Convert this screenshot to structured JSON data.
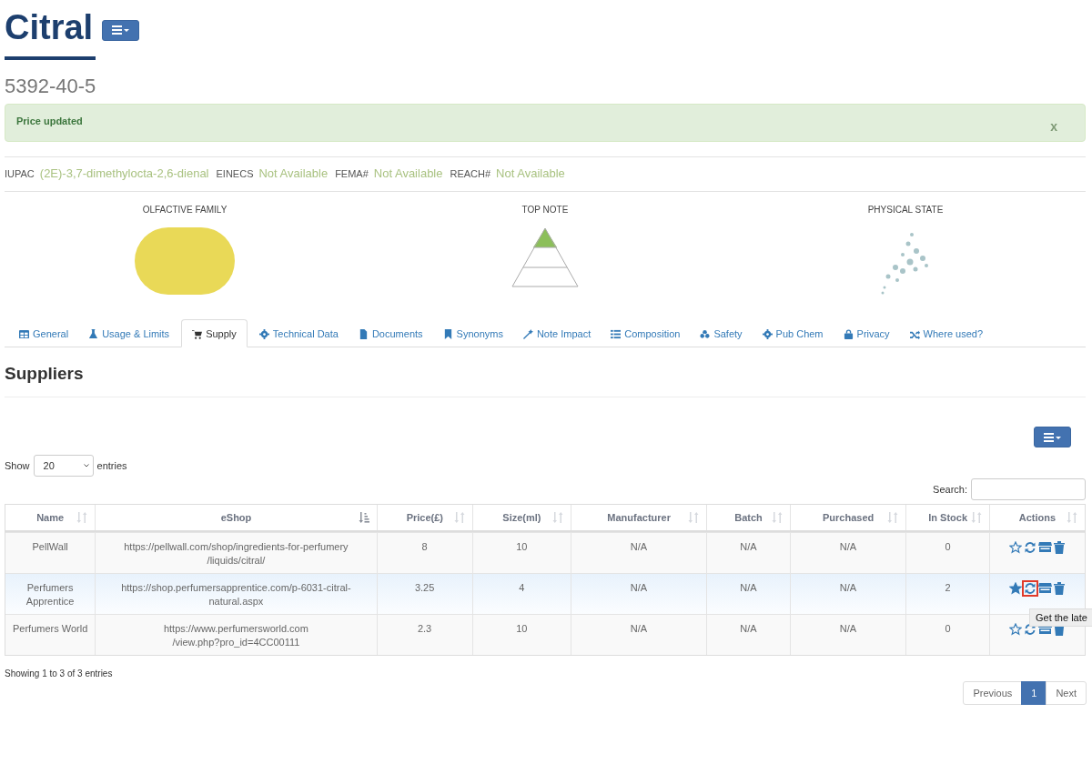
{
  "title": "Citral",
  "cas": "5392-40-5",
  "alert": {
    "text": "Price updated",
    "close": "x"
  },
  "identifiers": [
    {
      "label": "IUPAC",
      "value": "(2E)-3,7-dimethylocta-2,6-dienal"
    },
    {
      "label": "EINECS",
      "value": "Not Available"
    },
    {
      "label": "FEMA#",
      "value": "Not Available"
    },
    {
      "label": "REACH#",
      "value": "Not Available"
    }
  ],
  "profile": [
    {
      "label": "OLFACTIVE FAMILY",
      "kind": "photo"
    },
    {
      "label": "TOP NOTE",
      "kind": "pyramid"
    },
    {
      "label": "PHYSICAL STATE",
      "kind": "splash"
    }
  ],
  "tabs": [
    {
      "label": "General",
      "selected": false
    },
    {
      "label": "Usage & Limits",
      "selected": false
    },
    {
      "label": "Supply",
      "selected": true
    },
    {
      "label": "Technical Data",
      "selected": false
    },
    {
      "label": "Documents",
      "selected": false
    },
    {
      "label": "Synonyms",
      "selected": false
    },
    {
      "label": "Note Impact",
      "selected": false
    },
    {
      "label": "Composition",
      "selected": false
    },
    {
      "label": "Safety",
      "selected": false
    },
    {
      "label": "Pub Chem",
      "selected": false
    },
    {
      "label": "Privacy",
      "selected": false
    },
    {
      "label": "Where used?",
      "selected": false
    }
  ],
  "section_title": "Suppliers",
  "length": {
    "before": "Show",
    "value": "20",
    "after": "entries"
  },
  "search": {
    "label": "Search:"
  },
  "columns": [
    {
      "label": "Name",
      "sorted": false
    },
    {
      "label": "eShop",
      "sorted": true
    },
    {
      "label": "Price(£)",
      "sorted": false
    },
    {
      "label": "Size(ml)",
      "sorted": false
    },
    {
      "label": "Manufacturer",
      "sorted": false
    },
    {
      "label": "Batch",
      "sorted": false
    },
    {
      "label": "Purchased",
      "sorted": false
    },
    {
      "label": "In Stock",
      "sorted": false
    },
    {
      "label": "Actions",
      "sorted": false
    }
  ],
  "rows": [
    {
      "cells": [
        "PellWall",
        "https://pellwall.com/shop/ingredients-for-perfumery /liquids/citral/",
        "8",
        "10",
        "N/A",
        "N/A",
        "N/A",
        "0"
      ],
      "starred": false,
      "selected": false,
      "refresh_focused": false
    },
    {
      "cells": [
        "Perfumers Apprentice",
        "https://shop.perfumersapprentice.com/p-6031-citral-natural.aspx",
        "3.25",
        "4",
        "N/A",
        "N/A",
        "N/A",
        "2"
      ],
      "starred": true,
      "selected": true,
      "refresh_focused": true
    },
    {
      "cells": [
        "Perfumers World",
        "https://www.perfumersworld.com /view.php?pro_id=4CC00111",
        "2.3",
        "10",
        "N/A",
        "N/A",
        "N/A",
        "0"
      ],
      "starred": false,
      "selected": false,
      "refresh_focused": false
    }
  ],
  "tooltip": "Get the late",
  "info": "Showing 1 to 3 of 3 entries",
  "pagination": [
    {
      "label": "Previous",
      "selected": false
    },
    {
      "label": "1",
      "selected": true
    },
    {
      "label": "Next",
      "selected": false
    }
  ]
}
